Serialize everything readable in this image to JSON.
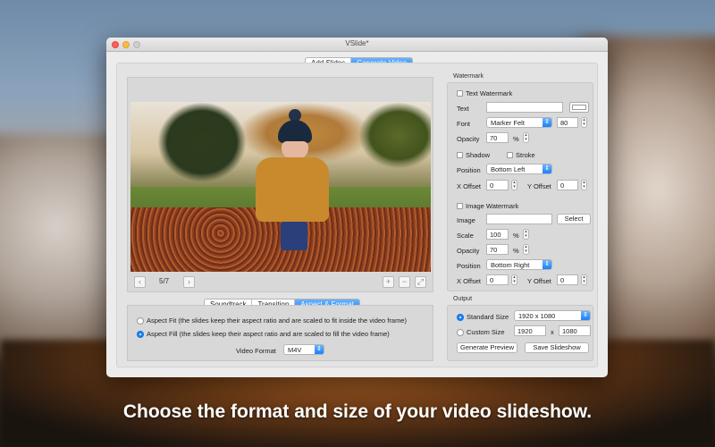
{
  "window": {
    "title": "VSlide*"
  },
  "mode_tabs": [
    {
      "label": "Add Slides",
      "active": false
    },
    {
      "label": "Generate Video",
      "active": true
    }
  ],
  "preview": {
    "page_indicator": "5/7"
  },
  "bottom_tabs": [
    {
      "label": "Soundtrack",
      "active": false
    },
    {
      "label": "Transition",
      "active": false
    },
    {
      "label": "Aspect & Format",
      "active": true
    }
  ],
  "aspect": {
    "fit_label": "Aspect Fit (the slides keep their aspect ratio and are scaled to fit inside the video frame)",
    "fill_label": "Aspect Fill (the slides keep their aspect ratio and are scaled to fill the video frame)",
    "selected": "fill",
    "video_format_label": "Video Format",
    "video_format_value": "M4V"
  },
  "watermark": {
    "section_title": "Watermark",
    "text_watermark_label": "Text Watermark",
    "text_label": "Text",
    "text_value": "",
    "font_label": "Font",
    "font_value": "Marker Felt",
    "font_size": "80",
    "opacity_label": "Opacity",
    "opacity_value": "70",
    "percent": "%",
    "shadow_label": "Shadow",
    "stroke_label": "Stroke",
    "position_label": "Position",
    "position_value": "Bottom Left",
    "x_offset_label": "X Offset",
    "x_offset_value": "0",
    "y_offset_label": "Y Offset",
    "y_offset_value": "0",
    "image_watermark_label": "Image Watermark",
    "image_label": "Image",
    "image_value": "",
    "select_label": "Select",
    "scale_label": "Scale",
    "scale_value": "100",
    "img_opacity_label": "Opacity",
    "img_opacity_value": "70",
    "img_position_label": "Position",
    "img_position_value": "Bottom Right",
    "img_x_offset_label": "X Offset",
    "img_x_offset_value": "0",
    "img_y_offset_label": "Y Offset",
    "img_y_offset_value": "0"
  },
  "output": {
    "section_title": "Output",
    "standard_size_label": "Standard Size",
    "standard_size_value": "1920 x 1080",
    "custom_size_label": "Custom Size",
    "custom_width": "1920",
    "x_sep": "x",
    "custom_height": "1080",
    "selected": "standard",
    "generate_preview_label": "Generate Preview",
    "save_slideshow_label": "Save Slideshow"
  },
  "caption": "Choose the format and size of your video slideshow.",
  "colors": {
    "accent": "#1a82fb",
    "window_bg": "#ececec"
  },
  "icons": [
    "close-light",
    "minimize-light",
    "zoom-light",
    "chevron-left-icon",
    "chevron-right-icon",
    "plus-icon",
    "minus-icon",
    "expand-icon",
    "popup-arrow-icon",
    "stepper-icon"
  ]
}
